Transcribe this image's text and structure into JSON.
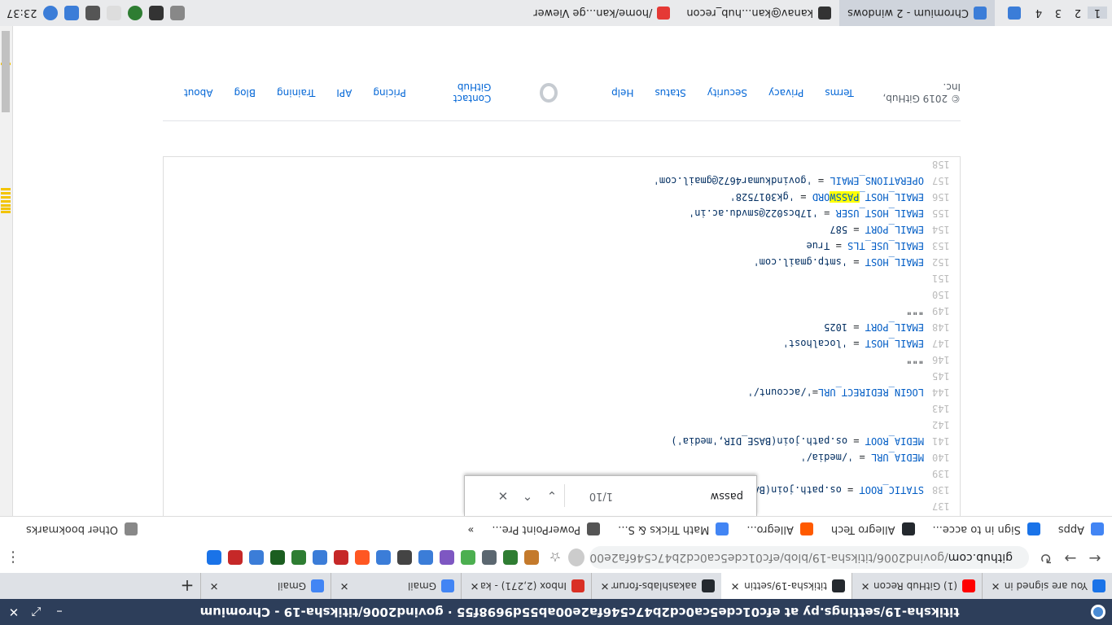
{
  "window": {
    "title": "titiksha-19/settings.py at efc01cde5ca0cd2b47c546fa2e00ab55d9698f55 · govind2006/titiksha-19 - Chromium"
  },
  "tabs": [
    {
      "label": "You are signed in",
      "icon": "sign-in-icon",
      "color": "#1a73e8"
    },
    {
      "label": "(1) GitHub Recon",
      "icon": "youtube-icon",
      "color": "#ff0000"
    },
    {
      "label": "titiksha-19/settin",
      "icon": "github-icon",
      "color": "#24292e",
      "active": true
    },
    {
      "label": "aakashlabs-forum",
      "icon": "github-icon",
      "color": "#24292e"
    },
    {
      "label": "Inbox (2,271) - ka",
      "icon": "gmail-icon",
      "color": "#d93025"
    },
    {
      "label": "Gmail",
      "icon": "google-icon",
      "color": "#4285f4"
    },
    {
      "label": "Gmail",
      "icon": "google-icon",
      "color": "#4285f4"
    }
  ],
  "toolbar": {
    "url_host": "github.com",
    "url_path": "/govind2006/titiksha-19/blob/efc01cde5ca0cd2b47c546fa2e00ab55...",
    "extension_colors": [
      "#c47a2c",
      "#2e7d32",
      "#5b6770",
      "#4caf50",
      "#7e57c2",
      "#3b7dd8",
      "#444",
      "#3b7dd8",
      "#ff5722",
      "#c62828",
      "#3b7dd8",
      "#2e7d32",
      "#1b5e20",
      "#3b7dd8",
      "#c62828",
      "#1a73e8"
    ]
  },
  "bookmarks": {
    "apps": "Apps",
    "items": [
      "Sign in to acce...",
      "Allegro Tech",
      "Allegro...",
      "Math Tricks & S...",
      "PowerPoint Pre..."
    ],
    "overflow": "»",
    "other": "Other bookmarks"
  },
  "find_bar": {
    "query": "passw",
    "count": "1/10"
  },
  "code": [
    {
      "n": "137",
      "text": ""
    },
    {
      "n": "138",
      "text": "STATIC_ROOT = os.path.join(BASE_DIR, 'assets')"
    },
    {
      "n": "139",
      "text": ""
    },
    {
      "n": "140",
      "text": "MEDIA_URL = '/media/'"
    },
    {
      "n": "141",
      "text": "MEDIA_ROOT = os.path.join(BASE_DIR,'media')"
    },
    {
      "n": "142",
      "text": ""
    },
    {
      "n": "143",
      "text": ""
    },
    {
      "n": "144",
      "text": "LOGIN_REDIRECT_URL='/account/'"
    },
    {
      "n": "145",
      "text": ""
    },
    {
      "n": "146",
      "text": "\"\"\""
    },
    {
      "n": "147",
      "text": "EMAIL_HOST = 'localhost'"
    },
    {
      "n": "148",
      "text": "EMAIL_PORT = 1025"
    },
    {
      "n": "149",
      "text": "\"\"\""
    },
    {
      "n": "150",
      "text": ""
    },
    {
      "n": "151",
      "text": ""
    },
    {
      "n": "152",
      "text": "EMAIL_HOST = 'smtp.gmail.com'"
    },
    {
      "n": "153",
      "text": "EMAIL_USE_TLS = True"
    },
    {
      "n": "154",
      "text": "EMAIL_PORT = 587"
    },
    {
      "n": "155",
      "text": "EMAIL_HOST_USER = '17bcs022@smvdu.ac.in'"
    },
    {
      "n": "156",
      "text": "EMAIL_HOST_PASSWORD = 'gk3017528'"
    },
    {
      "n": "157",
      "text": "OPERATIONS_EMAIL = 'govindkumar4672@gmail.com'"
    },
    {
      "n": "158",
      "text": ""
    }
  ],
  "footer": {
    "copyright": "© 2019 GitHub, Inc.",
    "left_links": [
      "Terms",
      "Privacy",
      "Security",
      "Status",
      "Help"
    ],
    "right_links": [
      "Contact GitHub",
      "Pricing",
      "API",
      "Training",
      "Blog",
      "About"
    ]
  },
  "panel": {
    "workspaces": [
      "1",
      "2",
      "3",
      "4"
    ],
    "tasks": [
      {
        "label": "Chromium - 2 windows",
        "active": true
      },
      {
        "label": "kanav@kan...hub_recon"
      },
      {
        "label": "/home/kan...ge Viewer"
      }
    ],
    "clock": "23:37"
  }
}
